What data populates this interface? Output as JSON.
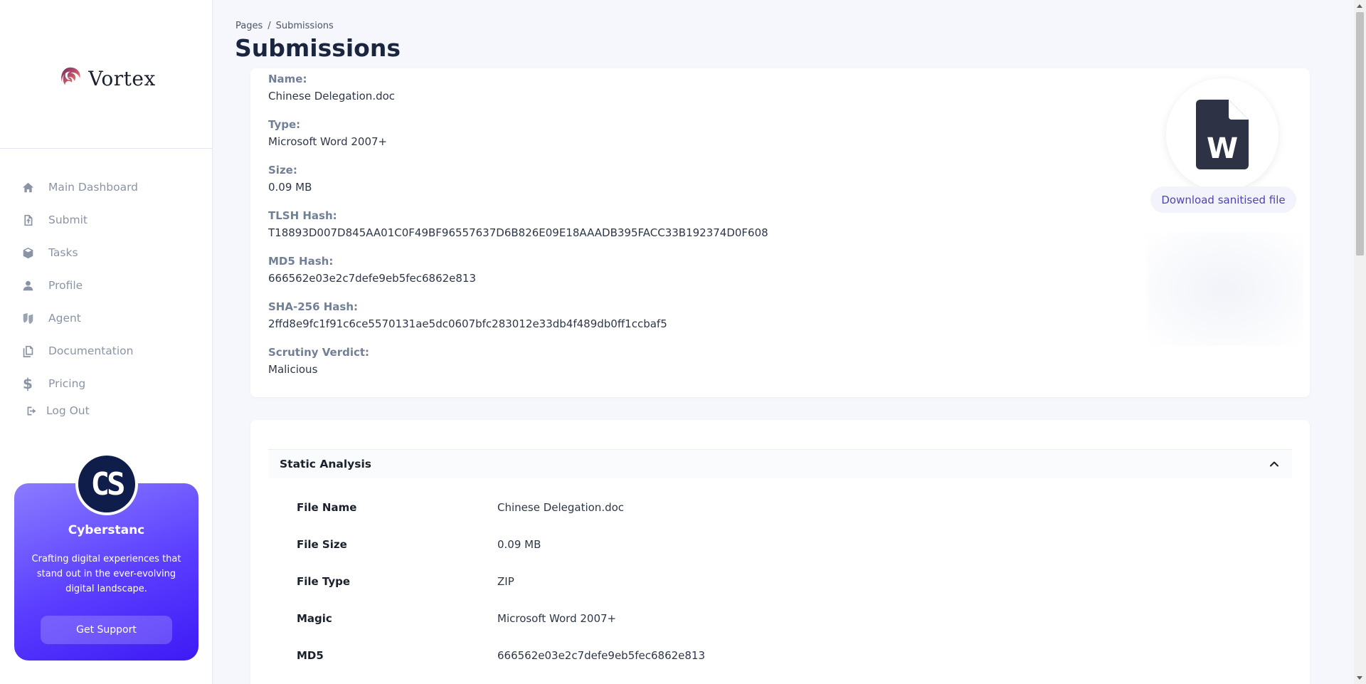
{
  "brand": {
    "name": "Vortex"
  },
  "sidebar": {
    "items": [
      {
        "label": "Main Dashboard",
        "icon": "home-icon"
      },
      {
        "label": "Submit",
        "icon": "upload-file-icon"
      },
      {
        "label": "Tasks",
        "icon": "cube-icon"
      },
      {
        "label": "Profile",
        "icon": "person-icon"
      },
      {
        "label": "Agent",
        "icon": "agent-icon"
      },
      {
        "label": "Documentation",
        "icon": "documents-icon"
      },
      {
        "label": "Pricing",
        "icon": "dollar-icon"
      }
    ],
    "logout": {
      "label": "Log Out",
      "icon": "logout-icon"
    },
    "promo": {
      "avatar_text": "CS",
      "title": "Cyberstanc",
      "text": "Crafting digital experiences that stand out in the ever-evolving digital landscape.",
      "button": "Get Support",
      "gradient_start": "#8a7cff",
      "gradient_end": "#3d1af5"
    }
  },
  "header": {
    "breadcrumb": [
      "Pages",
      "Submissions"
    ],
    "breadcrumb_separator": "/",
    "title": "Submissions"
  },
  "file_info": {
    "fields": [
      {
        "label": "Name:",
        "value": "Chinese Delegation.doc"
      },
      {
        "label": "Type:",
        "value": "Microsoft Word 2007+"
      },
      {
        "label": "Size:",
        "value": "0.09 MB"
      },
      {
        "label": "TLSH Hash:",
        "value": "T18893D007D845AA01C0F49BF96557637D6B826E09E18AAADB395FACC33B192374D0F608"
      },
      {
        "label": "MD5 Hash:",
        "value": "666562e03e2c7defe9eb5fec6862e813"
      },
      {
        "label": "SHA-256 Hash:",
        "value": "2ffd8e9fc1f91c6ce5570131ae5dc0607bfc283012e33db4f489db0ff1ccbaf5"
      },
      {
        "label": "Scrutiny Verdict:",
        "value": "Malicious"
      }
    ],
    "file_icon": "word-document-icon",
    "file_icon_letter": "W",
    "download_label": "Download sanitised file",
    "accent": "#4c44b4"
  },
  "static_analysis": {
    "title": "Static Analysis",
    "expanded": true,
    "rows": [
      {
        "key": "File Name",
        "value": "Chinese Delegation.doc"
      },
      {
        "key": "File Size",
        "value": "0.09 MB"
      },
      {
        "key": "File Type",
        "value": "ZIP"
      },
      {
        "key": "Magic",
        "value": "Microsoft Word 2007+"
      },
      {
        "key": "MD5",
        "value": "666562e03e2c7defe9eb5fec6862e813"
      }
    ]
  }
}
